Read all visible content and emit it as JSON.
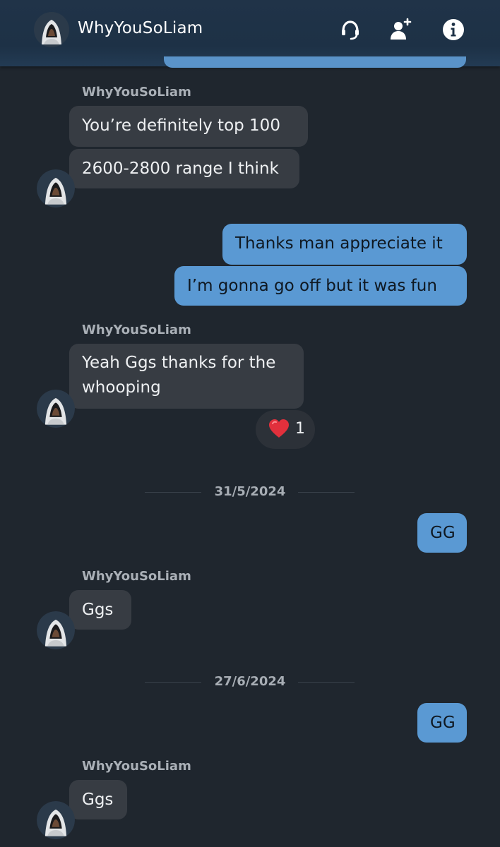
{
  "header": {
    "contact_name": "WhyYouSoLiam",
    "icons": [
      "headset-icon",
      "add-friend-icon",
      "info-icon"
    ]
  },
  "messages": [
    {
      "sender": "WhyYouSoLiam",
      "lines": [
        "You’re definitely top 100",
        "2600-2800 range I think"
      ]
    },
    {
      "self": true,
      "lines": [
        "Thanks man appreciate it",
        "I’m gonna go off but it was fun"
      ]
    },
    {
      "sender": "WhyYouSoLiam",
      "lines": [
        "Yeah Ggs thanks for the",
        "whooping"
      ],
      "reaction": {
        "emoji": "heart",
        "count": "1"
      }
    },
    {
      "date": "31/5/2024"
    },
    {
      "self": true,
      "lines": [
        "GG"
      ]
    },
    {
      "sender": "WhyYouSoLiam",
      "lines": [
        "Ggs"
      ]
    },
    {
      "date": "27/6/2024"
    },
    {
      "self": true,
      "lines": [
        "GG"
      ]
    },
    {
      "sender": "WhyYouSoLiam",
      "lines": [
        "Ggs"
      ]
    }
  ],
  "colors": {
    "background": "#1f262e",
    "header": "#1d3146",
    "incoming_bubble": "#373c43",
    "outgoing_bubble": "#5a99d3",
    "sender_name": "#aab0b7",
    "reaction_heart": "#e1303c"
  }
}
